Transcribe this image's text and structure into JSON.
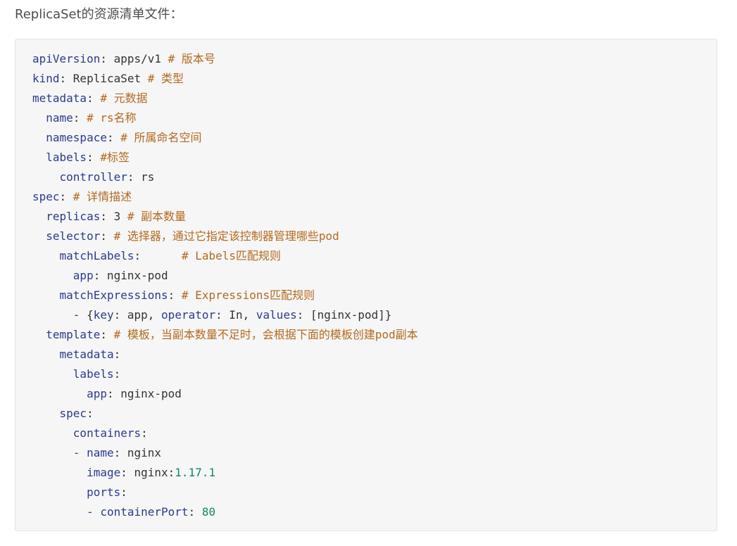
{
  "intro_text": "ReplicaSet的资源清单文件：",
  "colors": {
    "key": "#2b3a8f",
    "comment": "#b4691f",
    "number": "#11866f",
    "text": "#333333",
    "background": "#f6f6f6"
  },
  "code_lines": [
    [
      [
        "k",
        "apiVersion"
      ],
      [
        "s",
        ": apps/v1 "
      ],
      [
        "c",
        "# 版本号"
      ]
    ],
    [
      [
        "k",
        "kind"
      ],
      [
        "s",
        ": ReplicaSet "
      ],
      [
        "c",
        "# 类型"
      ]
    ],
    [
      [
        "k",
        "metadata"
      ],
      [
        "s",
        ": "
      ],
      [
        "c",
        "# 元数据"
      ]
    ],
    [
      [
        "s",
        "  "
      ],
      [
        "k",
        "name"
      ],
      [
        "s",
        ": "
      ],
      [
        "c",
        "# rs名称"
      ]
    ],
    [
      [
        "s",
        "  "
      ],
      [
        "k",
        "namespace"
      ],
      [
        "s",
        ": "
      ],
      [
        "c",
        "# 所属命名空间"
      ]
    ],
    [
      [
        "s",
        "  "
      ],
      [
        "k",
        "labels"
      ],
      [
        "s",
        ": "
      ],
      [
        "c",
        "#标签"
      ]
    ],
    [
      [
        "s",
        "    "
      ],
      [
        "k",
        "controller"
      ],
      [
        "s",
        ": rs"
      ]
    ],
    [
      [
        "k",
        "spec"
      ],
      [
        "s",
        ": "
      ],
      [
        "c",
        "# 详情描述"
      ]
    ],
    [
      [
        "s",
        "  "
      ],
      [
        "k",
        "replicas"
      ],
      [
        "s",
        ": 3 "
      ],
      [
        "c",
        "# 副本数量"
      ]
    ],
    [
      [
        "s",
        "  "
      ],
      [
        "k",
        "selector"
      ],
      [
        "s",
        ": "
      ],
      [
        "c",
        "# 选择器，通过它指定该控制器管理哪些pod"
      ]
    ],
    [
      [
        "s",
        "    "
      ],
      [
        "k",
        "matchLabels"
      ],
      [
        "s",
        ":      "
      ],
      [
        "c",
        "# Labels匹配规则"
      ]
    ],
    [
      [
        "s",
        "      "
      ],
      [
        "k",
        "app"
      ],
      [
        "s",
        ": nginx-pod"
      ]
    ],
    [
      [
        "s",
        "    "
      ],
      [
        "k",
        "matchExpressions"
      ],
      [
        "s",
        ": "
      ],
      [
        "c",
        "# Expressions匹配规则"
      ]
    ],
    [
      [
        "s",
        "      - {"
      ],
      [
        "k",
        "key"
      ],
      [
        "s",
        ": app, "
      ],
      [
        "k",
        "operator"
      ],
      [
        "s",
        ": In, "
      ],
      [
        "k",
        "values"
      ],
      [
        "s",
        ": [nginx-pod]}"
      ]
    ],
    [
      [
        "s",
        "  "
      ],
      [
        "k",
        "template"
      ],
      [
        "s",
        ": "
      ],
      [
        "c",
        "# 模板，当副本数量不足时，会根据下面的模板创建pod副本"
      ]
    ],
    [
      [
        "s",
        "    "
      ],
      [
        "k",
        "metadata"
      ],
      [
        "s",
        ":"
      ]
    ],
    [
      [
        "s",
        "      "
      ],
      [
        "k",
        "labels"
      ],
      [
        "s",
        ":"
      ]
    ],
    [
      [
        "s",
        "        "
      ],
      [
        "k",
        "app"
      ],
      [
        "s",
        ": nginx-pod"
      ]
    ],
    [
      [
        "s",
        "    "
      ],
      [
        "k",
        "spec"
      ],
      [
        "s",
        ":"
      ]
    ],
    [
      [
        "s",
        "      "
      ],
      [
        "k",
        "containers"
      ],
      [
        "s",
        ":"
      ]
    ],
    [
      [
        "s",
        "      "
      ],
      [
        "k",
        "- name"
      ],
      [
        "s",
        ": nginx"
      ]
    ],
    [
      [
        "s",
        "        "
      ],
      [
        "k",
        "image"
      ],
      [
        "s",
        ": nginx:"
      ],
      [
        "n",
        "1.17.1"
      ]
    ],
    [
      [
        "s",
        "        "
      ],
      [
        "k",
        "ports"
      ],
      [
        "s",
        ":"
      ]
    ],
    [
      [
        "s",
        "        "
      ],
      [
        "k",
        "- containerPort"
      ],
      [
        "s",
        ": "
      ],
      [
        "n",
        "80"
      ]
    ]
  ]
}
